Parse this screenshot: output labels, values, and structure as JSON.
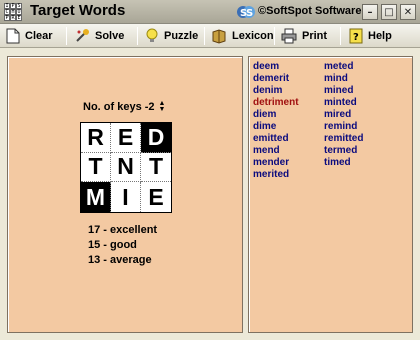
{
  "window": {
    "title": "Target Words",
    "app_icon_letters": [
      "I",
      "P",
      "S",
      "C",
      "H",
      "U",
      "P",
      "R",
      "E"
    ],
    "brand": "©SoftSpot Software",
    "buttons": [
      "minimize-icon",
      "maximize-icon",
      "close-icon"
    ]
  },
  "toolbar": {
    "items": [
      {
        "label": "Clear",
        "icon": "page-icon"
      },
      {
        "label": "Solve",
        "icon": "magic-wand-icon"
      },
      {
        "label": "Puzzle",
        "icon": "lightbulb-icon"
      },
      {
        "label": "Lexicon",
        "icon": "book-icon"
      },
      {
        "label": "Print",
        "icon": "printer-icon"
      },
      {
        "label": "Help",
        "icon": "help-icon"
      }
    ]
  },
  "puzzle": {
    "keys_label": "No. of keys -2",
    "grid": [
      {
        "letter": "R",
        "inverted": false
      },
      {
        "letter": "E",
        "inverted": false
      },
      {
        "letter": "D",
        "inverted": true
      },
      {
        "letter": "T",
        "inverted": false
      },
      {
        "letter": "N",
        "inverted": false
      },
      {
        "letter": "T",
        "inverted": false
      },
      {
        "letter": "M",
        "inverted": true
      },
      {
        "letter": "I",
        "inverted": false
      },
      {
        "letter": "E",
        "inverted": false
      }
    ],
    "scores": [
      "17 - excellent",
      "15 - good",
      "13 - average"
    ]
  },
  "words": {
    "col1": [
      "deem",
      "demerit",
      "denim",
      "detriment",
      "diem",
      "dime",
      "emitted",
      "mend",
      "mender",
      "merited"
    ],
    "col2": [
      "meted",
      "mind",
      "mined",
      "minted",
      "mired",
      "remind",
      "remitted",
      "termed",
      "timed"
    ],
    "highlighted": "detriment",
    "highlight_color": "#A01010",
    "word_color": "#0B0B7E"
  },
  "colors": {
    "panel": "#F3C9A2"
  }
}
